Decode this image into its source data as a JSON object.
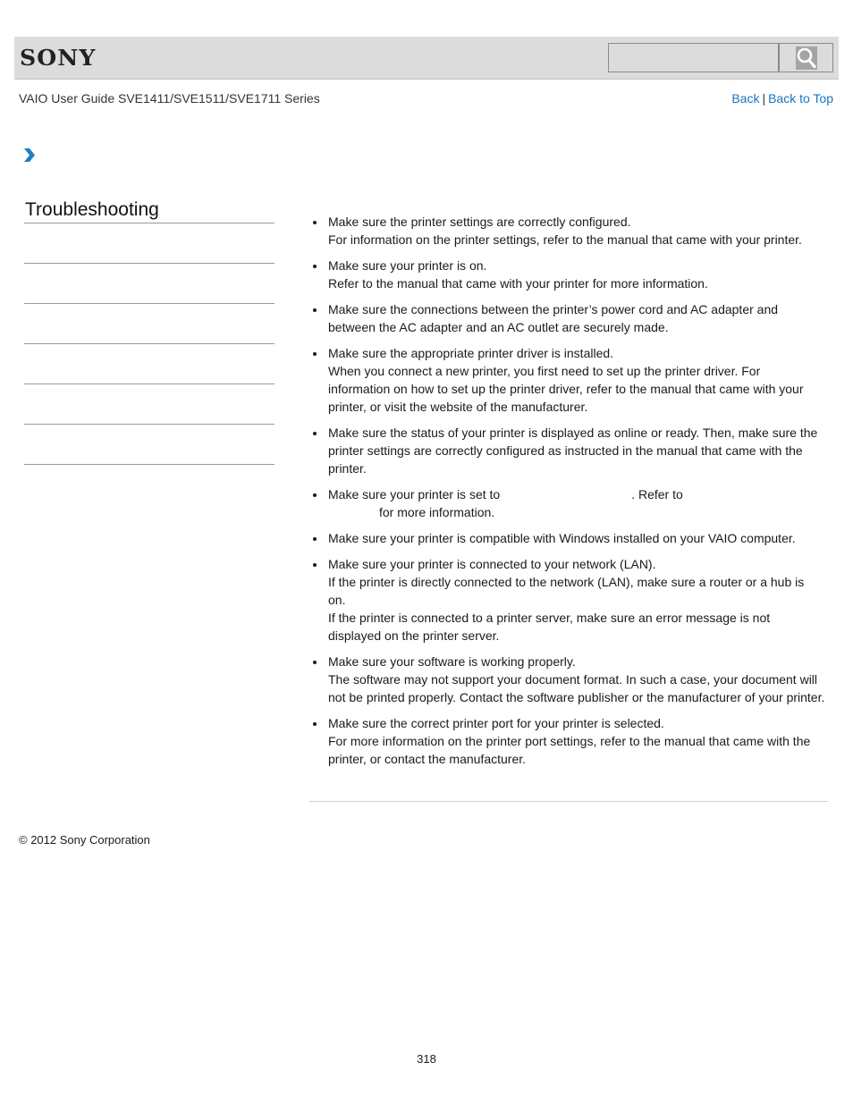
{
  "header": {
    "logo": "SONY",
    "search": {
      "value": "",
      "placeholder": "",
      "button_icon": "search-icon"
    }
  },
  "subheader": {
    "guide_title": "VAIO User Guide SVE1411/SVE1511/SVE1711 Series",
    "links": {
      "back": "Back",
      "separator": "|",
      "back_to_top": "Back to Top"
    }
  },
  "breadcrumb": {
    "icon": "chevron-right-icon",
    "accent_color": "#1f7fc4"
  },
  "sidebar": {
    "title": "Troubleshooting",
    "items": [
      "",
      "",
      "",
      "",
      "",
      ""
    ]
  },
  "content": {
    "bullets": [
      {
        "main": "Make sure the printer settings are correctly configured.",
        "details": [
          "For information on the printer settings, refer to the manual that came with your printer."
        ]
      },
      {
        "main": "Make sure your printer is on.",
        "details": [
          "Refer to the manual that came with your printer for more information."
        ]
      },
      {
        "main": "Make sure the connections between the printer’s power cord and AC adapter and between the AC adapter and an AC outlet are securely made.",
        "details": []
      },
      {
        "main": "Make sure the appropriate printer driver is installed.",
        "details": [
          "When you connect a new printer, you first need to set up the printer driver. For information on how to set up the printer driver, refer to the manual that came with your printer, or visit the website of the manufacturer."
        ]
      },
      {
        "main": "Make sure the status of your printer is displayed as online or ready. Then, make sure the printer settings are correctly configured as instructed in the manual that came with the printer.",
        "details": []
      },
      {
        "main_part1": "Make sure your printer is set to",
        "main_part2": ". Refer to",
        "main_part3": "for more information."
      },
      {
        "main": "Make sure your printer is compatible with Windows installed on your VAIO computer.",
        "details": []
      },
      {
        "main": "Make sure your printer is connected to your network (LAN).",
        "details": [
          "If the printer is directly connected to the network (LAN), make sure a router or a hub is on.",
          "If the printer is connected to a printer server, make sure an error message is not displayed on the printer server."
        ]
      },
      {
        "main": "Make sure your software is working properly.",
        "details": [
          "The software may not support your document format. In such a case, your document will not be printed properly. Contact the software publisher or the manufacturer of your printer."
        ]
      },
      {
        "main": "Make sure the correct printer port for your printer is selected.",
        "details": [
          "For more information on the printer port settings, refer to the manual that came with the printer, or contact the manufacturer."
        ]
      }
    ]
  },
  "footer": {
    "copyright": "© 2012 Sony Corporation",
    "page_number": "318"
  },
  "colors": {
    "header_bg": "#dcdcdc",
    "link": "#1a73c0",
    "accent": "#1f7fc4",
    "text": "#1a1a1a"
  }
}
